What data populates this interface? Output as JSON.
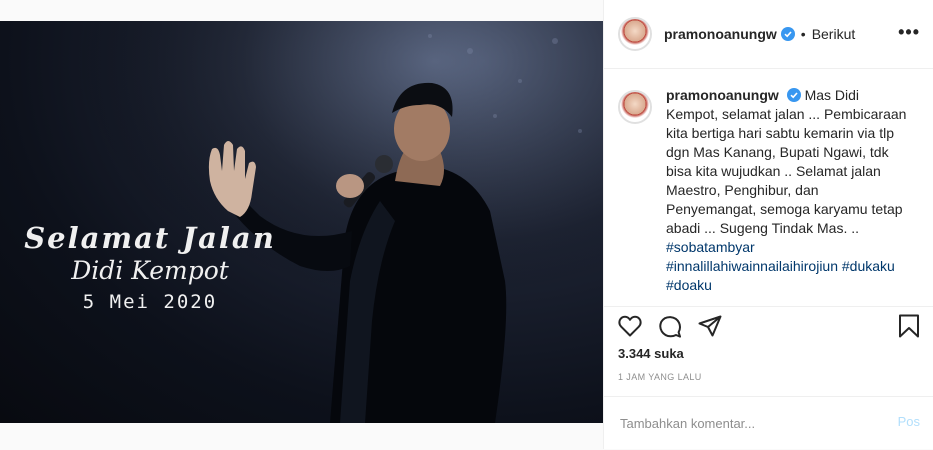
{
  "post": {
    "overlay": {
      "line1": "Selamat Jalan",
      "line2": "Didi Kempot",
      "line3": "5 Mei 2020"
    }
  },
  "header": {
    "username": "pramonoanungw",
    "separator": "•",
    "follow_label": "Berikut",
    "more_label": "•••"
  },
  "caption": {
    "username": "pramonoanungw",
    "text": "Mas Didi Kempot, selamat jalan ... Pembicaraan kita bertiga hari sabtu kemarin via tlp dgn Mas Kanang, Bupati Ngawi, tdk bisa kita wujudkan .. Selamat jalan Maestro, Penghibur, dan Penyemangat, semoga karyamu tetap abadi ... Sugeng Tindak Mas. ..",
    "hashtags": [
      "#sobatambyar",
      "#innalillahiwainnailaihirojiun #dukaku",
      "#doaku"
    ]
  },
  "actions": {
    "icons": [
      "heart-icon",
      "comment-icon",
      "share-icon",
      "bookmark-icon"
    ]
  },
  "stats": {
    "likes": "3.344 suka",
    "time": "1 JAM YANG LALU"
  },
  "comment_box": {
    "placeholder": "Tambahkan komentar...",
    "post_label": "Pos"
  },
  "colors": {
    "verified": "#3897f0",
    "hashtag": "#00376b",
    "post_disabled": "#b2dffc",
    "border": "#efefef"
  }
}
